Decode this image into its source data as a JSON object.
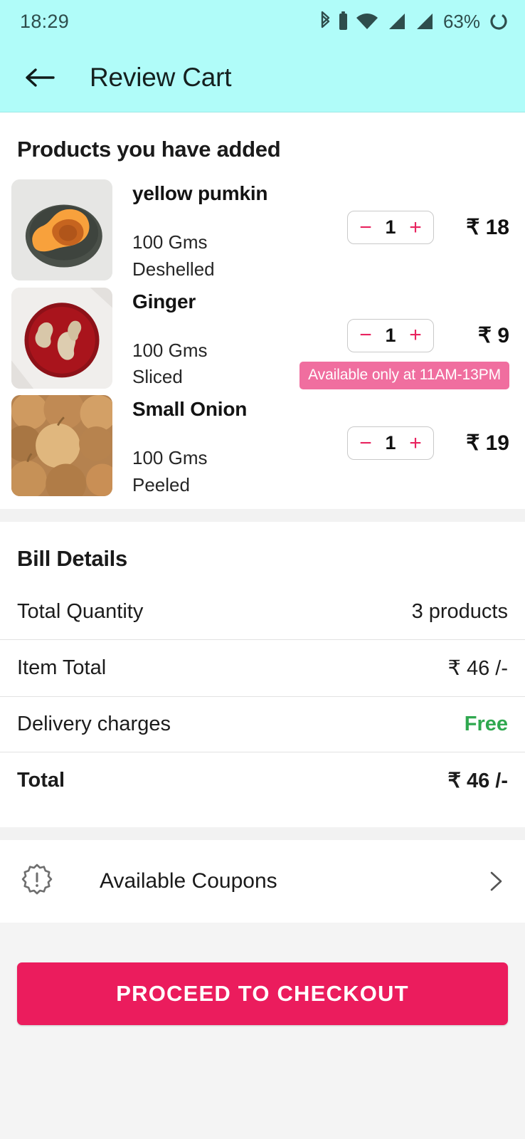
{
  "statusbar": {
    "time": "18:29",
    "battery_percent": "63%",
    "icons": [
      "bluetooth-icon",
      "battery-small-icon",
      "wifi-icon",
      "signal-bars-icon",
      "signal-bars-2-icon",
      "battery-ring-icon"
    ]
  },
  "appbar": {
    "back_icon": "back-arrow-icon",
    "title": "Review Cart",
    "background": "#b0fcf9"
  },
  "products_section": {
    "title": "Products you have added",
    "items": [
      {
        "name": "yellow pumkin",
        "weight": "100 Gms",
        "variant": "Deshelled",
        "quantity": "1",
        "price": "₹ 18",
        "decrement": "−",
        "increment": "+",
        "badge": null,
        "image": "yellow-pumpkin-photo"
      },
      {
        "name": "Ginger",
        "weight": "100 Gms",
        "variant": "Sliced",
        "quantity": "1",
        "price": "₹ 9",
        "decrement": "−",
        "increment": "+",
        "badge": "Available only at 11AM-13PM",
        "image": "ginger-photo"
      },
      {
        "name": "Small Onion",
        "weight": "100 Gms",
        "variant": "Peeled",
        "quantity": "1",
        "price": "₹ 19",
        "decrement": "−",
        "increment": "+",
        "badge": null,
        "image": "small-onion-photo"
      }
    ]
  },
  "bill": {
    "title": "Bill Details",
    "rows": [
      {
        "label": "Total Quantity",
        "value": "3 products"
      },
      {
        "label": "Item Total",
        "value": "₹ 46 /-"
      },
      {
        "label": "Delivery charges",
        "value": "Free"
      },
      {
        "label": "Total",
        "value": "₹ 46 /-"
      }
    ]
  },
  "coupons": {
    "icon": "coupon-badge-icon",
    "label": "Available Coupons",
    "chevron": "chevron-right-icon"
  },
  "checkout": {
    "label": "PROCEED TO CHECKOUT"
  },
  "colors": {
    "accent_pink": "#eb1c5d",
    "badge_pink": "#f06e9f",
    "header_cyan": "#b0fcf9",
    "free_green": "#2fa84f",
    "page_gray": "#f4f4f4"
  }
}
